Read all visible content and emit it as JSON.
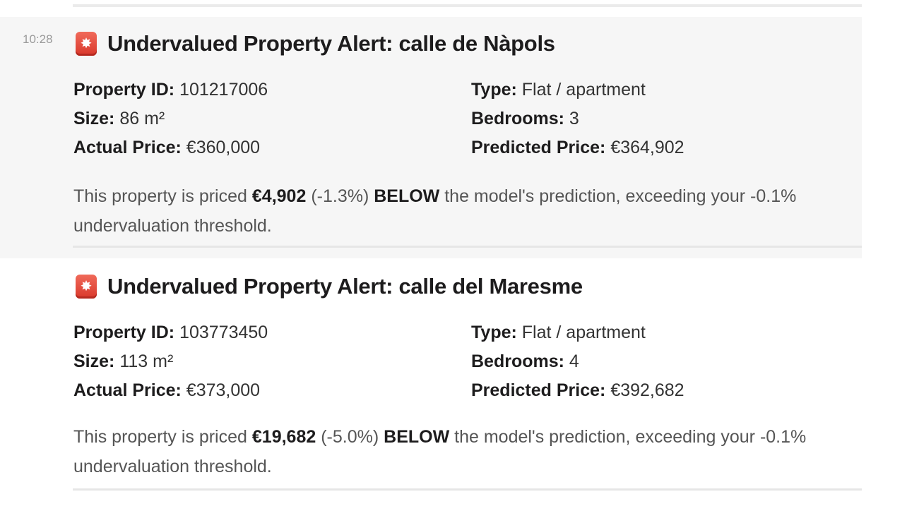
{
  "messages": [
    {
      "timestamp": "10:28",
      "icon": "red-alert-badge-icon",
      "title": "Undervalued Property Alert: calle de Nàpols",
      "fields": {
        "property_id": {
          "label": "Property ID:",
          "value": "101217006"
        },
        "type": {
          "label": "Type:",
          "value": "Flat / apartment"
        },
        "size": {
          "label": "Size:",
          "value": "86 m²"
        },
        "bedrooms": {
          "label": "Bedrooms:",
          "value": "3"
        },
        "actual_price": {
          "label": "Actual Price:",
          "value": "€360,000"
        },
        "predicted_price": {
          "label": "Predicted Price:",
          "value": "€364,902"
        }
      },
      "summary": {
        "prefix": "This property is priced",
        "diff_amount": "€4,902",
        "diff_pct": "(-1.3%)",
        "below": "BELOW",
        "suffix": "the model's prediction, exceeding your -0.1% undervaluation threshold."
      }
    },
    {
      "timestamp": "",
      "icon": "red-alert-badge-icon",
      "title": "Undervalued Property Alert: calle del Maresme",
      "fields": {
        "property_id": {
          "label": "Property ID:",
          "value": "103773450"
        },
        "type": {
          "label": "Type:",
          "value": "Flat / apartment"
        },
        "size": {
          "label": "Size:",
          "value": "113 m²"
        },
        "bedrooms": {
          "label": "Bedrooms:",
          "value": "4"
        },
        "actual_price": {
          "label": "Actual Price:",
          "value": "€373,000"
        },
        "predicted_price": {
          "label": "Predicted Price:",
          "value": "€392,682"
        }
      },
      "summary": {
        "prefix": "This property is priced",
        "diff_amount": "€19,682",
        "diff_pct": "(-5.0%)",
        "below": "BELOW",
        "suffix": "the model's prediction, exceeding your -0.1% undervaluation threshold."
      }
    }
  ],
  "colors": {
    "hover_background": "#f6f6f6",
    "alert_icon": "#e04a3d",
    "timestamp": "#9a9a9a"
  }
}
